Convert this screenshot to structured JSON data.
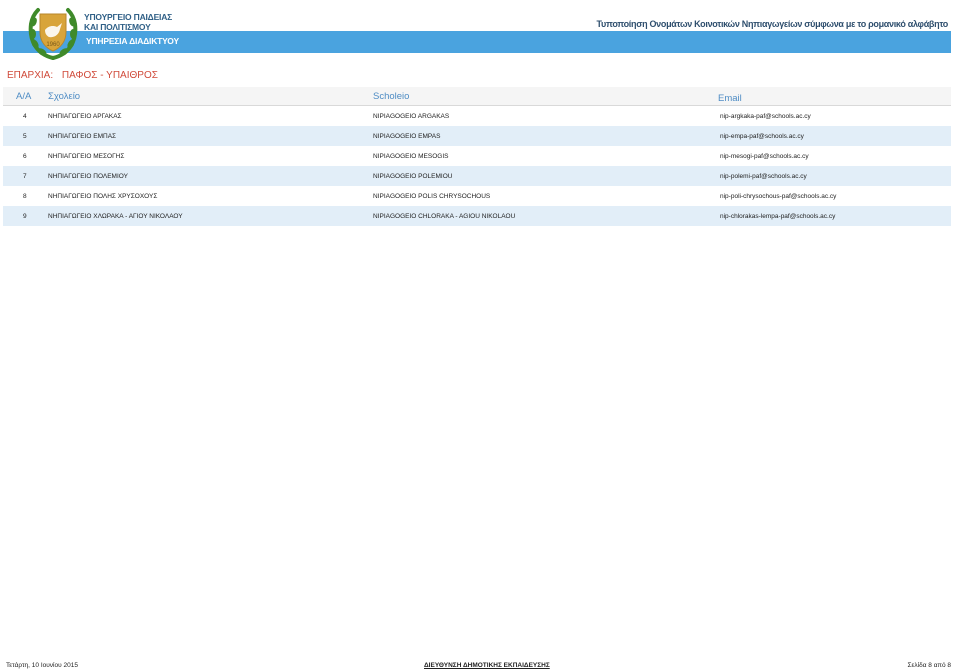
{
  "header": {
    "ministry_line1": "ΥΠΟΥΡΓΕΙΟ ΠΑΙΔΕΙΑΣ",
    "ministry_line2": "ΚΑΙ ΠΟΛΙΤΙΣΜΟΥ",
    "service": "ΥΠΗΡΕΣΙΑ ΔΙΑΔΙΚΤΥΟΥ",
    "title": "Τυποποίηση Ονομάτων Κοινοτικών Νηπιαγωγείων σύμφωνα με το ρομανικό αλφάβητο",
    "colors": {
      "bar": "#4aa3df",
      "emblem_green": "#3f8a2a",
      "emblem_gold": "#d8a43a"
    }
  },
  "district": {
    "label": "ΕΠΑΡΧΙΑ:",
    "value": "ΠΑΦΟΣ - ΥΠΑΙΘΡΟΣ"
  },
  "table": {
    "columns": [
      "Α/Α",
      "Σχολείο",
      "Scholeio",
      "Email"
    ],
    "rows": [
      [
        "4",
        "ΝΗΠΙΑΓΩΓΕΙΟ ΑΡΓΑΚΑΣ",
        "NIPIAGOGEIO ARGAKAS",
        "nip-argkaka-paf@schools.ac.cy"
      ],
      [
        "5",
        "ΝΗΠΙΑΓΩΓΕΙΟ ΕΜΠΑΣ",
        "NIPIAGOGEIO EMPAS",
        "nip-empa-paf@schools.ac.cy"
      ],
      [
        "6",
        "ΝΗΠΙΑΓΩΓΕΙΟ ΜΕΣΟΓΗΣ",
        "NIPIAGOGEIO MESOGIS",
        "nip-mesogi-paf@schools.ac.cy"
      ],
      [
        "7",
        "ΝΗΠΙΑΓΩΓΕΙΟ ΠΟΛΕΜΙΟΥ",
        "NIPIAGOGEIO POLEMIOU",
        "nip-polemi-paf@schools.ac.cy"
      ],
      [
        "8",
        "ΝΗΠΙΑΓΩΓΕΙΟ ΠΟΛΗΣ ΧΡΥΣΟΧΟΥΣ",
        "NIPIAGOGEIO POLIS CHRYSOCHOUS",
        "nip-poli-chrysochous-paf@schools.ac.cy"
      ],
      [
        "9",
        "ΝΗΠΙΑΓΩΓΕΙΟ ΧΛΩΡΑΚΑ - ΑΓΙΟΥ ΝΙΚΟΛΑΟΥ",
        "NIPIAGOGEIO CHLORAKA - AGIOU NIKOLAOU",
        "nip-chlorakas-lempa-paf@schools.ac.cy"
      ]
    ]
  },
  "footer": {
    "date": "Τετάρτη, 10 Ιουνίου 2015",
    "department": "ΔΙΕΥΘΥΝΣΗ ΔΗΜΟΤΙΚΗΣ ΕΚΠΑΙΔΕΥΣΗΣ",
    "page": "Σελίδα 8 από 8"
  }
}
